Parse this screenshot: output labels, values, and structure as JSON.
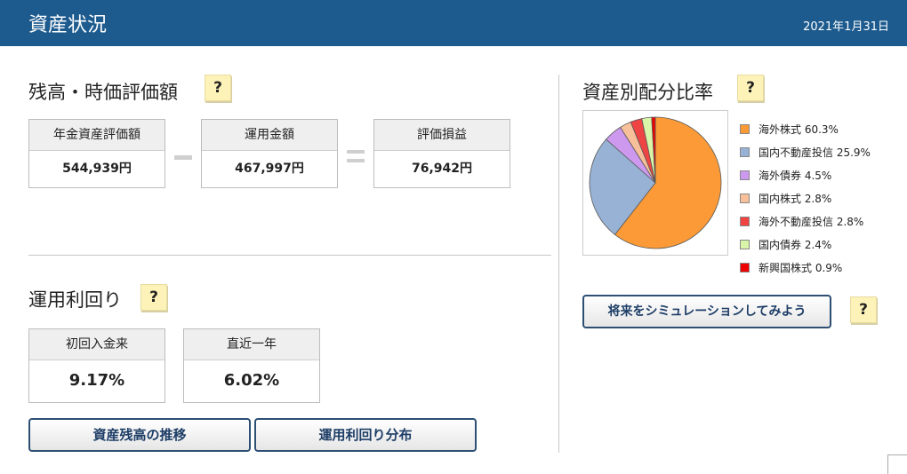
{
  "header": {
    "title": "資産状況",
    "date": "2021年1月31日"
  },
  "balance": {
    "title": "残高・時価評価額",
    "help": "?",
    "boxes": [
      {
        "label": "年金資産評価額",
        "value": "544,939円"
      },
      {
        "label": "運用金額",
        "value": "467,997円"
      },
      {
        "label": "評価損益",
        "value": "76,942円"
      }
    ]
  },
  "yield": {
    "title": "運用利回り",
    "help": "?",
    "boxes": [
      {
        "label": "初回入金来",
        "value": "9.17%"
      },
      {
        "label": "直近一年",
        "value": "6.02%"
      }
    ],
    "buttons": {
      "history": "資産残高の推移",
      "distribution": "運用利回り分布"
    }
  },
  "allocation": {
    "title": "資産別配分比率",
    "help": "?",
    "simulate_button": "将来をシミュレーションしてみよう",
    "simulate_help": "?",
    "colors": [
      "#fb9a37",
      "#97b2d5",
      "#cc99ee",
      "#f8c09a",
      "#ee4444",
      "#d8f5a8",
      "#ee0000"
    ],
    "legend": [
      "海外株式 60.3%",
      "国内不動産投信 25.9%",
      "海外債券 4.5%",
      "国内株式 2.8%",
      "海外不動産投信 2.8%",
      "国内債券 2.4%",
      "新興国株式 0.9%"
    ]
  },
  "chart_data": {
    "type": "pie",
    "categories": [
      "海外株式",
      "国内不動産投信",
      "海外債券",
      "国内株式",
      "海外不動産投信",
      "国内債券",
      "新興国株式"
    ],
    "values": [
      60.3,
      25.9,
      4.5,
      2.8,
      2.8,
      2.4,
      0.9
    ]
  }
}
